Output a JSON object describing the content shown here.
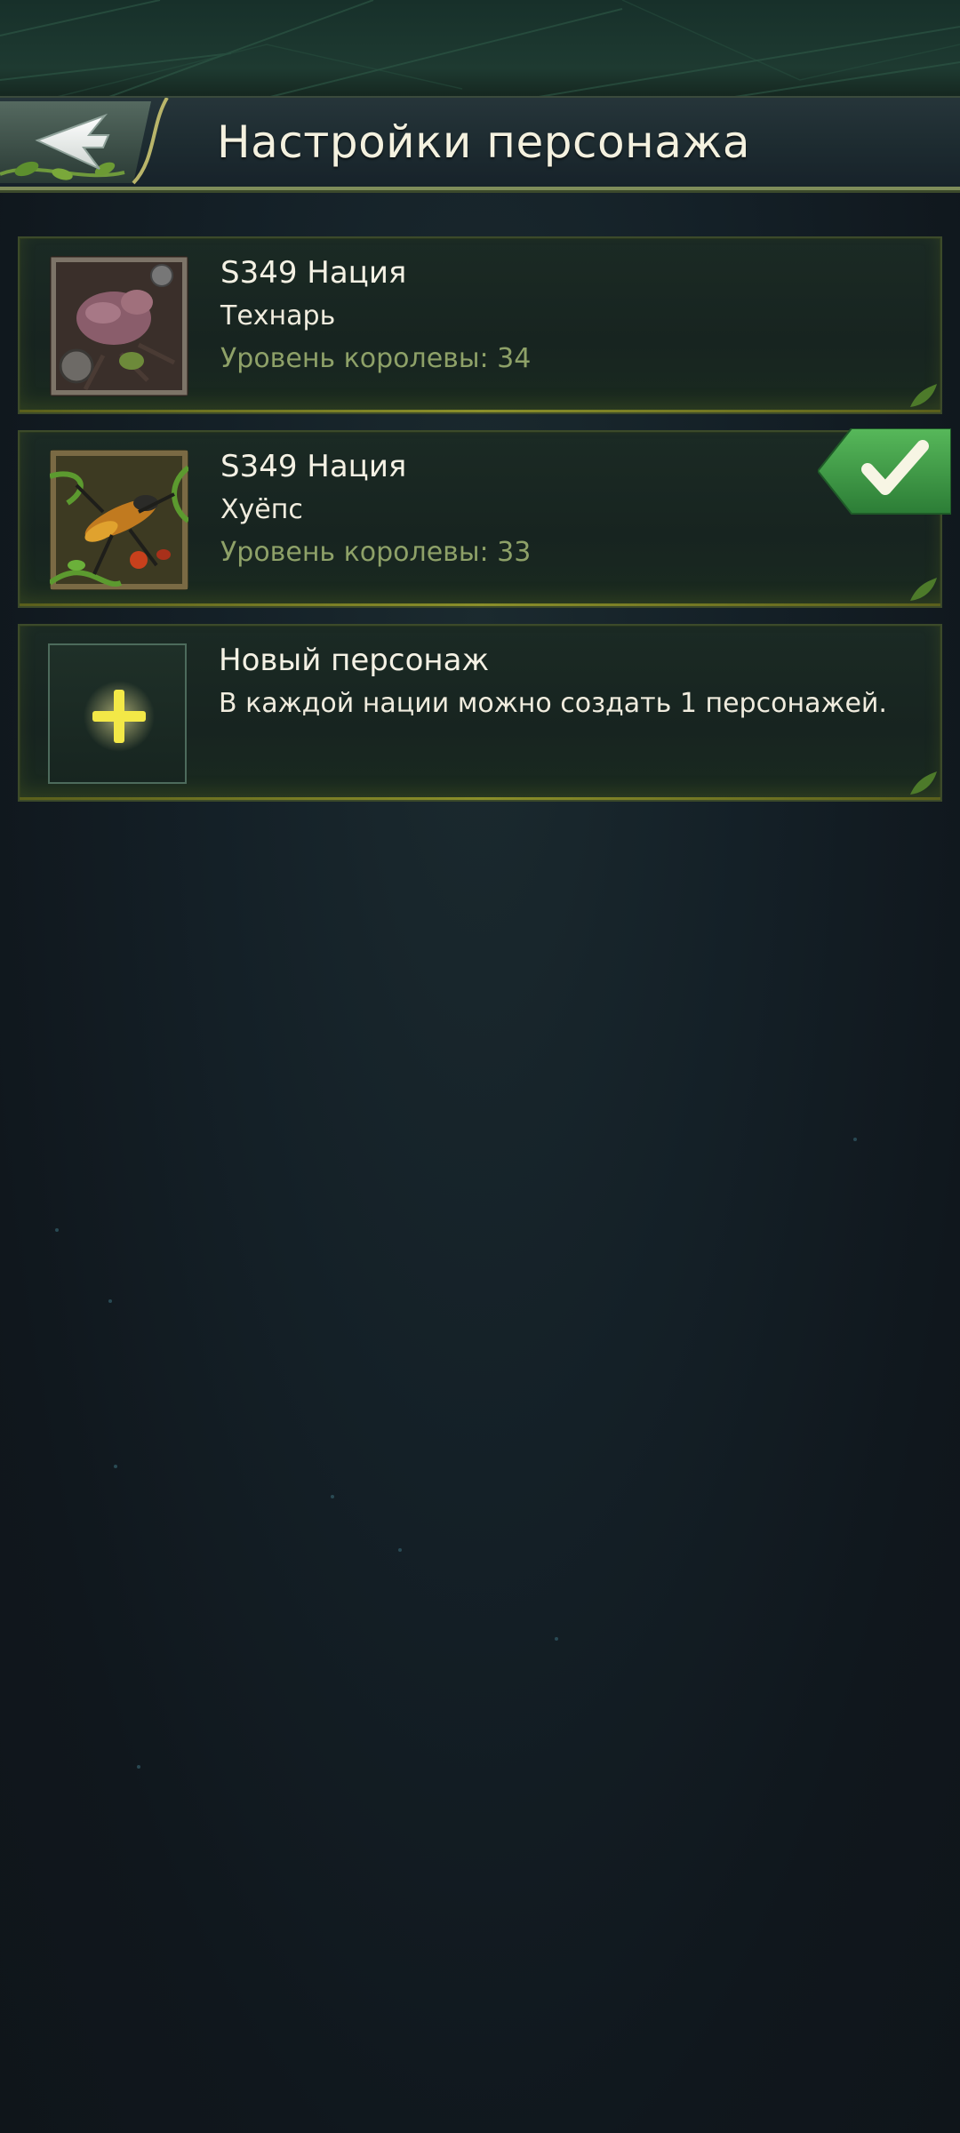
{
  "header": {
    "title": "Настройки персонажа"
  },
  "characters": [
    {
      "nation": "S349 Нация",
      "name": "Технарь",
      "queen_level": "Уровень королевы: 34",
      "selected": false
    },
    {
      "nation": "S349 Нация",
      "name": "Хуёпс",
      "queen_level": "Уровень королевы: 33",
      "selected": true
    }
  ],
  "new_character": {
    "title": "Новый персонаж",
    "description": "В каждой нации можно создать 1 персонажей."
  },
  "colors": {
    "accent_green": "#3d9a45",
    "level_text": "#8ea168",
    "plus_glow": "#f2e84a"
  }
}
